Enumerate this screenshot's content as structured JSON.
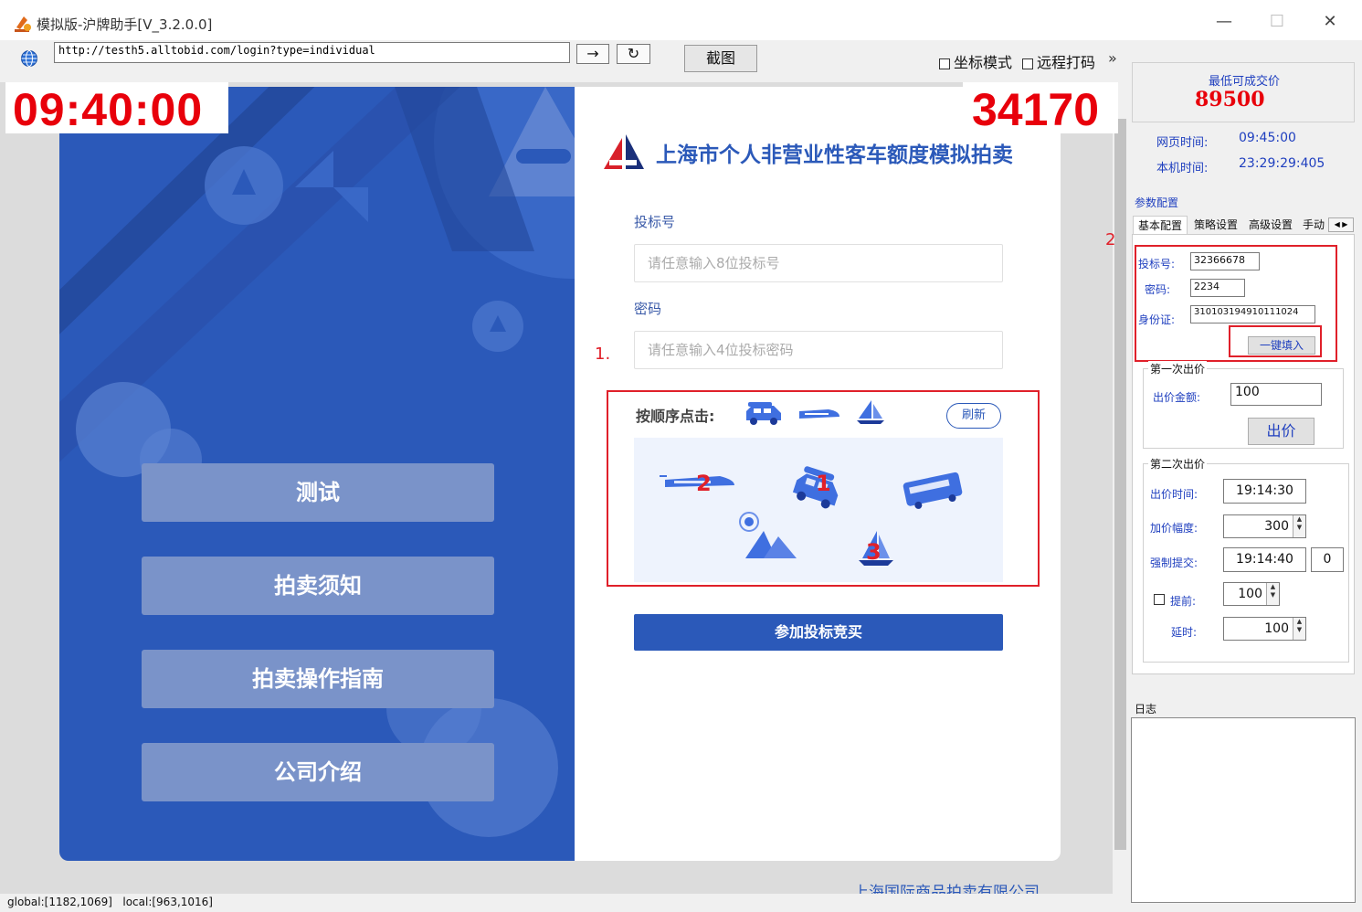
{
  "window": {
    "title": "模拟版-沪牌助手[V_3.2.0.0]",
    "minimize": "—",
    "maximize": "☐",
    "close": "✕"
  },
  "toolbar": {
    "url": "http://testh5.alltobid.com/login?type=individual",
    "go": "→",
    "refresh": "↻",
    "screenshot": "截图",
    "coord_mode": "坐标模式",
    "remote_captcha": "远程打码",
    "more": "»"
  },
  "overlay": {
    "clock": "09:40:00",
    "price": "34170"
  },
  "site": {
    "title": "上海市个人非营业性客车额度模拟拍卖",
    "menu": [
      "测试",
      "拍卖须知",
      "拍卖操作指南",
      "公司介绍"
    ],
    "bid_label": "投标号",
    "bid_placeholder": "请任意输入8位投标号",
    "pwd_label": "密码",
    "pwd_placeholder": "请任意输入4位投标密码",
    "captcha_label": "按顺序点击:",
    "refresh": "刷新",
    "submit": "参加投标竞买",
    "footer": "上海国际商品拍卖有限公司",
    "annotation_1": "1.",
    "captcha_numbers": [
      "2",
      "1",
      "3"
    ]
  },
  "annotation_2": "2",
  "status": {
    "global": "global:[1182,1069]",
    "local": "local:[963,1016]"
  },
  "panel": {
    "min_price_label": "最低可成交价",
    "min_price": "89500",
    "web_time_label": "网页时间:",
    "web_time": "09:45:00",
    "local_time_label": "本机时间:",
    "local_time": "23:29:29:405",
    "config_title": "参数配置",
    "tabs": [
      "基本配置",
      "策略设置",
      "高级设置",
      "手动"
    ],
    "bid_no_label": "投标号:",
    "bid_no": "32366678",
    "pwd_label": "密码:",
    "pwd": "2234",
    "id_label": "身份证:",
    "id": "310103194910111024",
    "fill_btn": "一键填入",
    "first_bid_title": "第一次出价",
    "amount_label": "出价金额:",
    "amount": "100",
    "bid_btn": "出价",
    "second_bid_title": "第二次出价",
    "bid_time_label": "出价时间:",
    "bid_time": "19:14:30",
    "increment_label": "加价幅度:",
    "increment": "300",
    "force_label": "强制提交:",
    "force_time": "19:14:40",
    "force_extra": "0",
    "advance_label": "提前:",
    "advance": "100",
    "delay_label": "延时:",
    "delay": "100",
    "log_title": "日志"
  }
}
